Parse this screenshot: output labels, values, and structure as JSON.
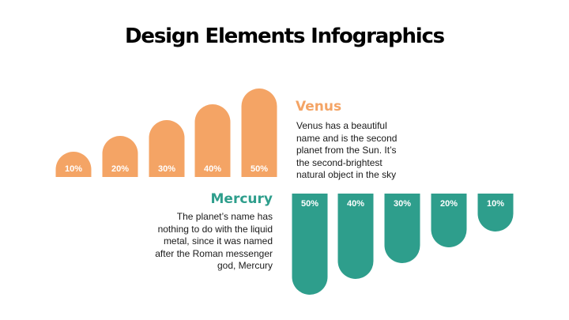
{
  "title": "Design Elements Infographics",
  "colors": {
    "venus": "#F4A465",
    "mercury": "#2E9E8C"
  },
  "venus": {
    "title": "Venus",
    "text": "Venus has a beautiful name and is the second planet from the Sun. It’s the second-brightest natural object in the sky"
  },
  "mercury": {
    "title": "Mercury",
    "text": "The planet’s name has nothing to do with the liquid metal, since it was named after the Roman messenger god, Mercury"
  },
  "chart_data": [
    {
      "type": "bar",
      "categories": [
        "10%",
        "20%",
        "30%",
        "40%",
        "50%"
      ],
      "values": [
        10,
        20,
        30,
        40,
        50
      ],
      "orientation": "upward"
    },
    {
      "type": "bar",
      "categories": [
        "50%",
        "40%",
        "30%",
        "20%",
        "10%"
      ],
      "values": [
        50,
        40,
        30,
        20,
        10
      ],
      "orientation": "downward"
    }
  ]
}
